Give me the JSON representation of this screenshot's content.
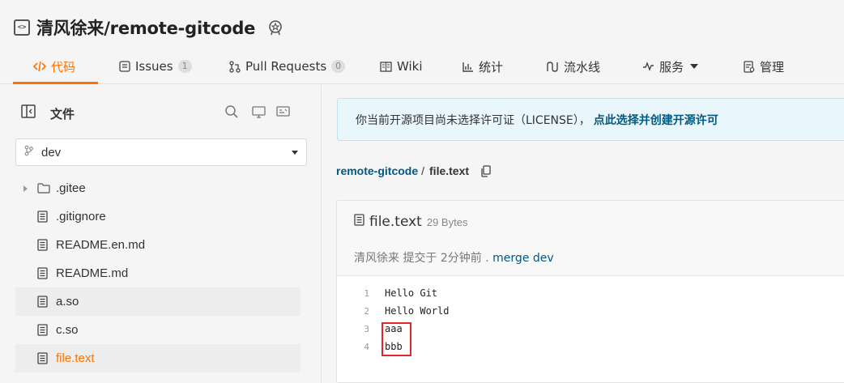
{
  "repo": {
    "title": "清风徐来/remote-gitcode",
    "icon": "code-repo-icon",
    "badge_icon": "recommended-badge-icon"
  },
  "tabs": [
    {
      "label": "代码",
      "icon": "code-icon",
      "active": true
    },
    {
      "label": "Issues",
      "icon": "issues-icon",
      "count": "1"
    },
    {
      "label": "Pull Requests",
      "icon": "pull-request-icon",
      "count": "0"
    },
    {
      "label": "Wiki",
      "icon": "wiki-icon"
    },
    {
      "label": "统计",
      "icon": "stats-icon"
    },
    {
      "label": "流水线",
      "icon": "pipeline-icon"
    },
    {
      "label": "服务",
      "icon": "service-icon"
    },
    {
      "label": "管理",
      "icon": "manage-icon"
    }
  ],
  "sidebar": {
    "title": "文件",
    "branch": "dev",
    "files": [
      {
        "name": ".gitee",
        "type": "folder"
      },
      {
        "name": ".gitignore",
        "type": "file"
      },
      {
        "name": "README.en.md",
        "type": "file"
      },
      {
        "name": "README.md",
        "type": "file"
      },
      {
        "name": "a.so",
        "type": "file"
      },
      {
        "name": "c.so",
        "type": "file"
      },
      {
        "name": "file.text",
        "type": "file",
        "current": true
      }
    ]
  },
  "license": {
    "text": "你当前开源项目尚未选择许可证（LICENSE），",
    "link": "点此选择并创建开源许可"
  },
  "breadcrumb": {
    "repo": "remote-gitcode",
    "separator": "/",
    "file": "file.text"
  },
  "file": {
    "name": "file.text",
    "size": "29 Bytes",
    "author": "清风徐来",
    "commit_info": " 提交于 2分钟前 . ",
    "commit_msg": "merge dev",
    "lines": [
      {
        "num": "1",
        "text": "Hello Git"
      },
      {
        "num": "2",
        "text": "Hello World"
      },
      {
        "num": "3",
        "text": "aaa"
      },
      {
        "num": "4",
        "text": "bbb"
      }
    ]
  },
  "colors": {
    "accent": "#fe7300",
    "link": "#005980",
    "highlight_box": "#e0282a"
  }
}
